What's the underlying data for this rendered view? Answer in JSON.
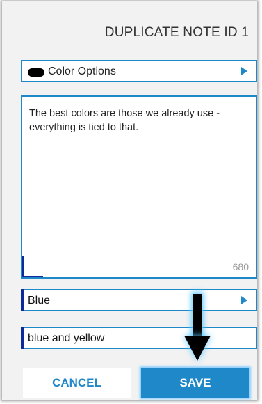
{
  "header": {
    "title": "DUPLICATE NOTE ID 1"
  },
  "color_options": {
    "label": "Color Options",
    "swatch_color": "#000000"
  },
  "note": {
    "text": "The best colors are those we already use - everything is tied to that.",
    "char_count": "680"
  },
  "fields": {
    "color_select_value": "Blue",
    "tag_value": "blue and yellow"
  },
  "buttons": {
    "cancel": "CANCEL",
    "save": "SAVE"
  },
  "colors": {
    "accent": "#1e88c8",
    "marker": "#0d2a9a",
    "arrow_glow": "#5ac8ff"
  },
  "annotation": {
    "icon": "down-arrow-icon"
  }
}
